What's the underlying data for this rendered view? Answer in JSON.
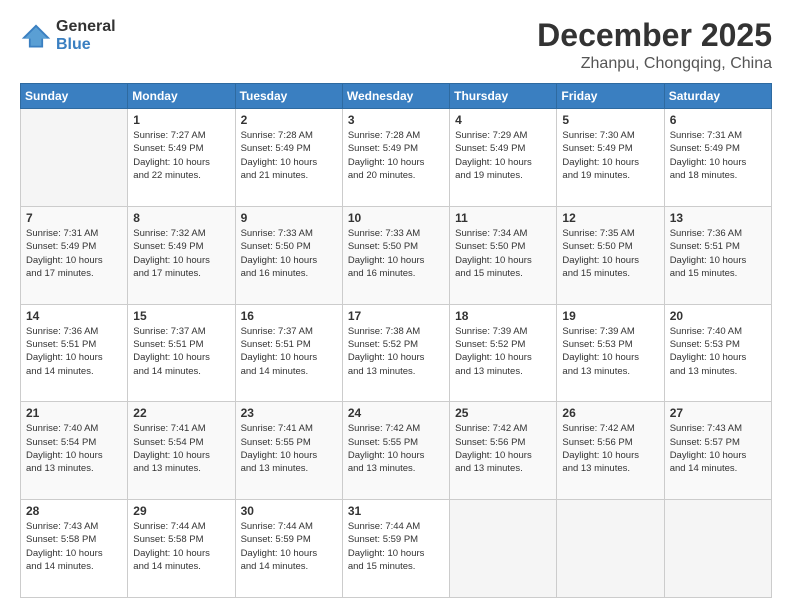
{
  "header": {
    "logo_general": "General",
    "logo_blue": "Blue",
    "title": "December 2025",
    "location": "Zhanpu, Chongqing, China"
  },
  "columns": [
    "Sunday",
    "Monday",
    "Tuesday",
    "Wednesday",
    "Thursday",
    "Friday",
    "Saturday"
  ],
  "rows": [
    [
      {
        "day": "",
        "info": ""
      },
      {
        "day": "1",
        "info": "Sunrise: 7:27 AM\nSunset: 5:49 PM\nDaylight: 10 hours\nand 22 minutes."
      },
      {
        "day": "2",
        "info": "Sunrise: 7:28 AM\nSunset: 5:49 PM\nDaylight: 10 hours\nand 21 minutes."
      },
      {
        "day": "3",
        "info": "Sunrise: 7:28 AM\nSunset: 5:49 PM\nDaylight: 10 hours\nand 20 minutes."
      },
      {
        "day": "4",
        "info": "Sunrise: 7:29 AM\nSunset: 5:49 PM\nDaylight: 10 hours\nand 19 minutes."
      },
      {
        "day": "5",
        "info": "Sunrise: 7:30 AM\nSunset: 5:49 PM\nDaylight: 10 hours\nand 19 minutes."
      },
      {
        "day": "6",
        "info": "Sunrise: 7:31 AM\nSunset: 5:49 PM\nDaylight: 10 hours\nand 18 minutes."
      }
    ],
    [
      {
        "day": "7",
        "info": "Sunrise: 7:31 AM\nSunset: 5:49 PM\nDaylight: 10 hours\nand 17 minutes."
      },
      {
        "day": "8",
        "info": "Sunrise: 7:32 AM\nSunset: 5:49 PM\nDaylight: 10 hours\nand 17 minutes."
      },
      {
        "day": "9",
        "info": "Sunrise: 7:33 AM\nSunset: 5:50 PM\nDaylight: 10 hours\nand 16 minutes."
      },
      {
        "day": "10",
        "info": "Sunrise: 7:33 AM\nSunset: 5:50 PM\nDaylight: 10 hours\nand 16 minutes."
      },
      {
        "day": "11",
        "info": "Sunrise: 7:34 AM\nSunset: 5:50 PM\nDaylight: 10 hours\nand 15 minutes."
      },
      {
        "day": "12",
        "info": "Sunrise: 7:35 AM\nSunset: 5:50 PM\nDaylight: 10 hours\nand 15 minutes."
      },
      {
        "day": "13",
        "info": "Sunrise: 7:36 AM\nSunset: 5:51 PM\nDaylight: 10 hours\nand 15 minutes."
      }
    ],
    [
      {
        "day": "14",
        "info": "Sunrise: 7:36 AM\nSunset: 5:51 PM\nDaylight: 10 hours\nand 14 minutes."
      },
      {
        "day": "15",
        "info": "Sunrise: 7:37 AM\nSunset: 5:51 PM\nDaylight: 10 hours\nand 14 minutes."
      },
      {
        "day": "16",
        "info": "Sunrise: 7:37 AM\nSunset: 5:51 PM\nDaylight: 10 hours\nand 14 minutes."
      },
      {
        "day": "17",
        "info": "Sunrise: 7:38 AM\nSunset: 5:52 PM\nDaylight: 10 hours\nand 13 minutes."
      },
      {
        "day": "18",
        "info": "Sunrise: 7:39 AM\nSunset: 5:52 PM\nDaylight: 10 hours\nand 13 minutes."
      },
      {
        "day": "19",
        "info": "Sunrise: 7:39 AM\nSunset: 5:53 PM\nDaylight: 10 hours\nand 13 minutes."
      },
      {
        "day": "20",
        "info": "Sunrise: 7:40 AM\nSunset: 5:53 PM\nDaylight: 10 hours\nand 13 minutes."
      }
    ],
    [
      {
        "day": "21",
        "info": "Sunrise: 7:40 AM\nSunset: 5:54 PM\nDaylight: 10 hours\nand 13 minutes."
      },
      {
        "day": "22",
        "info": "Sunrise: 7:41 AM\nSunset: 5:54 PM\nDaylight: 10 hours\nand 13 minutes."
      },
      {
        "day": "23",
        "info": "Sunrise: 7:41 AM\nSunset: 5:55 PM\nDaylight: 10 hours\nand 13 minutes."
      },
      {
        "day": "24",
        "info": "Sunrise: 7:42 AM\nSunset: 5:55 PM\nDaylight: 10 hours\nand 13 minutes."
      },
      {
        "day": "25",
        "info": "Sunrise: 7:42 AM\nSunset: 5:56 PM\nDaylight: 10 hours\nand 13 minutes."
      },
      {
        "day": "26",
        "info": "Sunrise: 7:42 AM\nSunset: 5:56 PM\nDaylight: 10 hours\nand 13 minutes."
      },
      {
        "day": "27",
        "info": "Sunrise: 7:43 AM\nSunset: 5:57 PM\nDaylight: 10 hours\nand 14 minutes."
      }
    ],
    [
      {
        "day": "28",
        "info": "Sunrise: 7:43 AM\nSunset: 5:58 PM\nDaylight: 10 hours\nand 14 minutes."
      },
      {
        "day": "29",
        "info": "Sunrise: 7:44 AM\nSunset: 5:58 PM\nDaylight: 10 hours\nand 14 minutes."
      },
      {
        "day": "30",
        "info": "Sunrise: 7:44 AM\nSunset: 5:59 PM\nDaylight: 10 hours\nand 14 minutes."
      },
      {
        "day": "31",
        "info": "Sunrise: 7:44 AM\nSunset: 5:59 PM\nDaylight: 10 hours\nand 15 minutes."
      },
      {
        "day": "",
        "info": ""
      },
      {
        "day": "",
        "info": ""
      },
      {
        "day": "",
        "info": ""
      }
    ]
  ]
}
